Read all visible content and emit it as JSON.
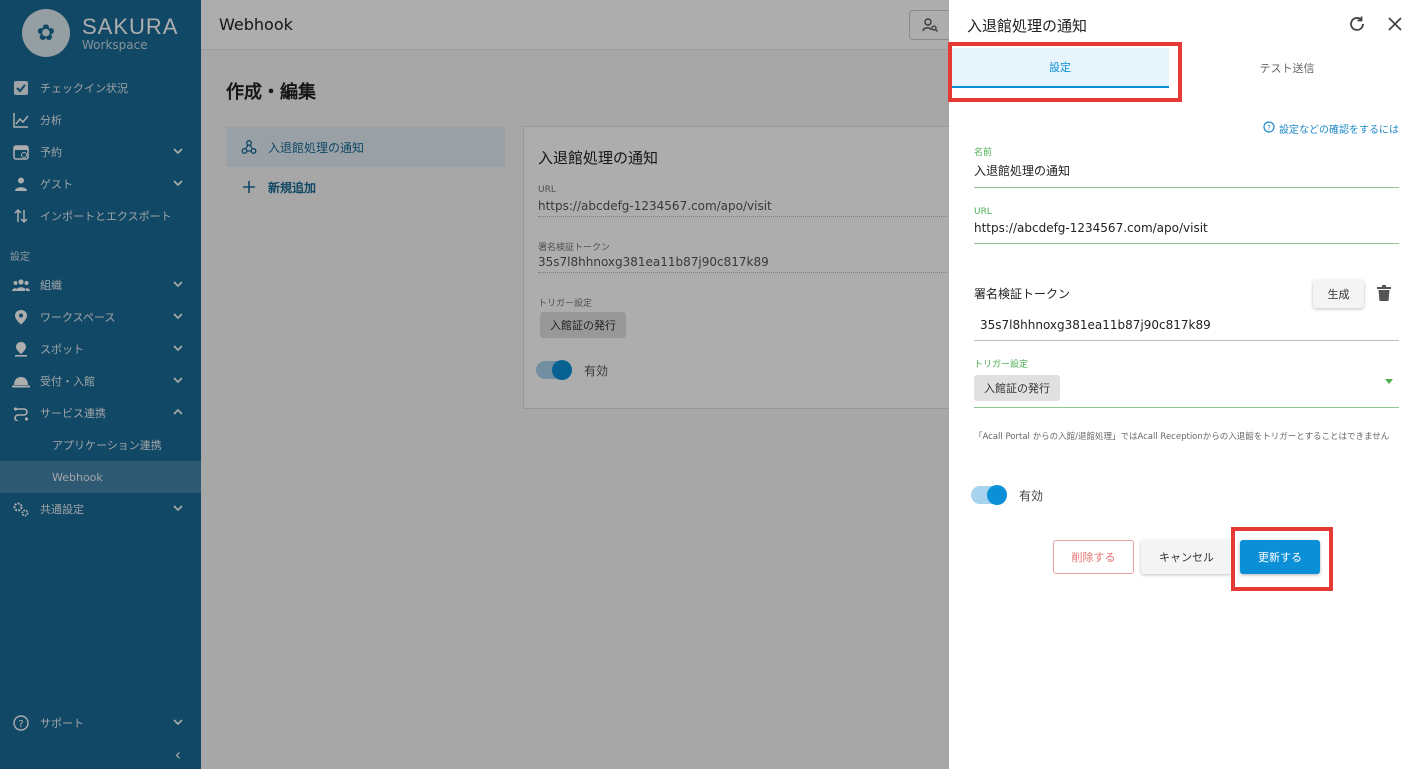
{
  "brand": {
    "title": "SAKURA",
    "subtitle": "Workspace"
  },
  "sidebar": {
    "items": [
      {
        "label": "チェックイン状況",
        "icon": "checkbox-icon"
      },
      {
        "label": "分析",
        "icon": "chart-line-icon"
      },
      {
        "label": "予約",
        "icon": "calendar-icon"
      },
      {
        "label": "ゲスト",
        "icon": "guest-icon"
      },
      {
        "label": "インポートとエクスポート",
        "icon": "import-export-icon"
      }
    ],
    "section_label": "設定",
    "settings_items": [
      {
        "label": "組織",
        "icon": "group-icon"
      },
      {
        "label": "ワークスペース",
        "icon": "location-pin-icon"
      },
      {
        "label": "スポット",
        "icon": "spot-pin-icon"
      },
      {
        "label": "受付・入館",
        "icon": "reception-bell-icon"
      },
      {
        "label": "サービス連携",
        "icon": "integration-icon"
      }
    ],
    "sub_items": [
      {
        "label": "アプリケーション連携"
      },
      {
        "label": "Webhook"
      }
    ],
    "common_settings": {
      "label": "共通設定",
      "icon": "gears-icon"
    },
    "support": {
      "label": "サポート",
      "icon": "help-circle-icon"
    },
    "collapse_glyph": "‹"
  },
  "main": {
    "topbar_title": "Webhook",
    "page_title": "作成・編集",
    "list": [
      {
        "label": "入退館処理の通知"
      },
      {
        "label": "新規追加"
      }
    ],
    "detail": {
      "title": "入退館処理の通知",
      "url_label": "URL",
      "url_value": "https://abcdefg-1234567.com/apo/visit",
      "token_label": "署名検証トークン",
      "token_value": "35s7l8hhnoxg381ea11b87j90c817k89",
      "trigger_label": "トリガー設定",
      "trigger_chip": "入館証の発行",
      "enabled_label": "有効"
    }
  },
  "drawer": {
    "title": "入退館処理の通知",
    "tabs": [
      {
        "label": "設定"
      },
      {
        "label": "テスト送信"
      }
    ],
    "help_link": "設定などの確認をするには",
    "name_label": "名前",
    "name_value": "入退館処理の通知",
    "url_label": "URL",
    "url_value": "https://abcdefg-1234567.com/apo/visit",
    "token_label": "署名検証トークン",
    "generate_button": "生成",
    "token_value": "35s7l8hhnoxg381ea11b87j90c817k89",
    "trigger_label": "トリガー設定",
    "trigger_chip": "入館証の発行",
    "note": "「Acall Portal からの入館/退館処理」ではAcall Receptionからの入退館をトリガーとすることはできません",
    "enabled_label": "有効",
    "delete_button": "削除する",
    "cancel_button": "キャンセル",
    "update_button": "更新する"
  },
  "colors": {
    "sidebar": "#1a6a96",
    "accent": "#0b8fd6",
    "highlight": "#e53935",
    "field_ok": "#4caf50"
  }
}
